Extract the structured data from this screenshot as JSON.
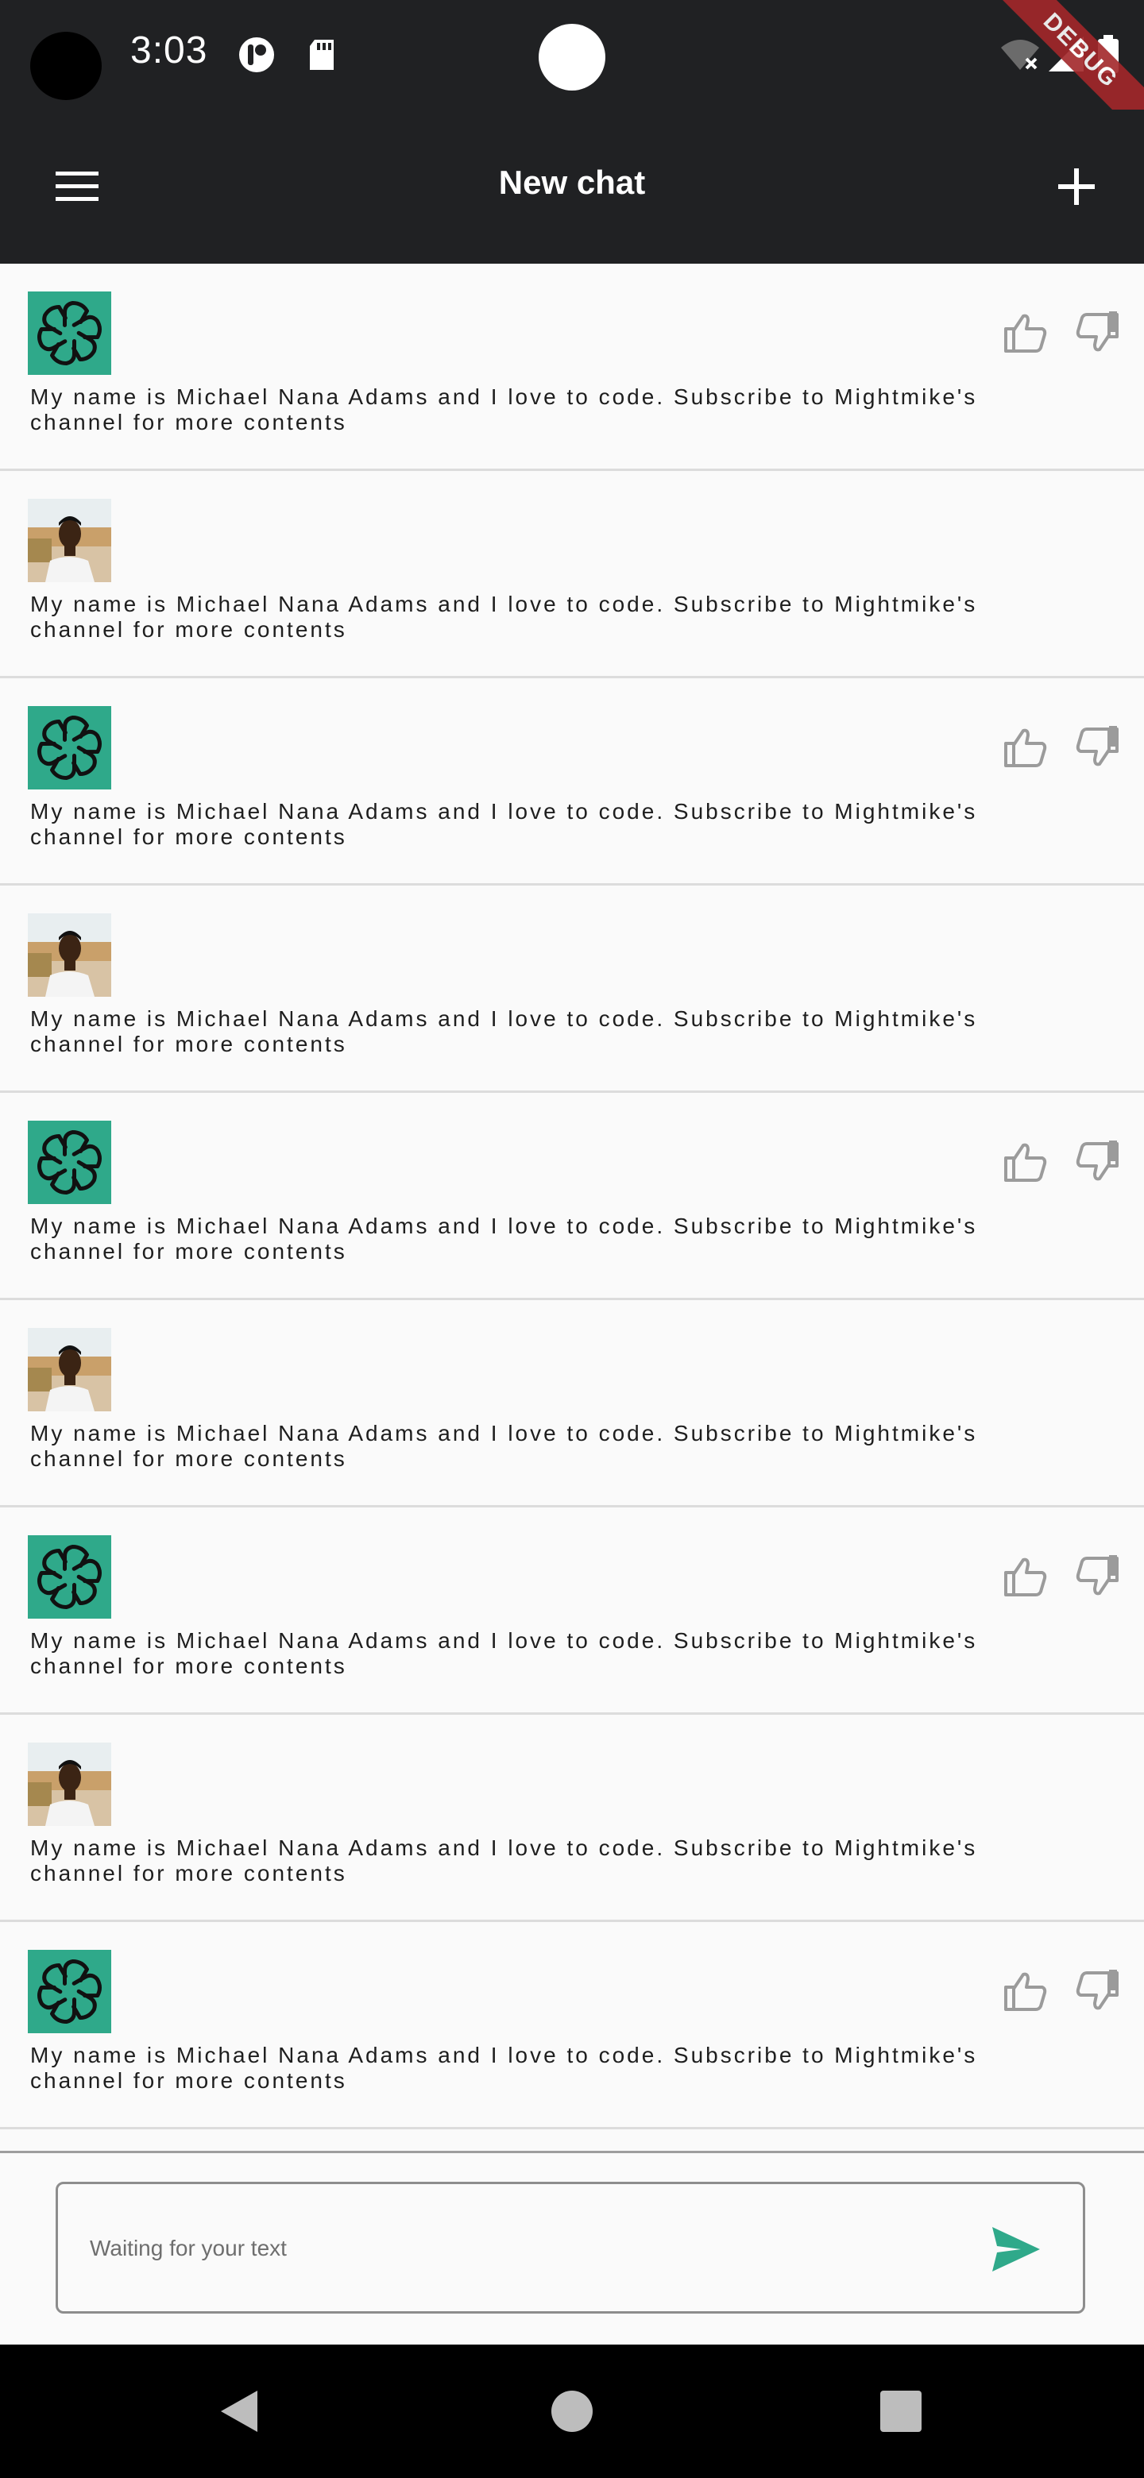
{
  "status_bar": {
    "time": "3:03",
    "icons": [
      "camera-hole",
      "app-notification-icon",
      "sd-card-icon",
      "wifi-off-icon",
      "signal-icon",
      "battery-icon"
    ],
    "debug_banner": "DEBUG"
  },
  "app_bar": {
    "title": "New chat",
    "menu_icon": "hamburger-menu-icon",
    "action_icon": "plus-icon"
  },
  "colors": {
    "app_bar": "#202123",
    "bot_avatar": "#2fa98a",
    "accent": "#10a37f",
    "background": "#fafafa"
  },
  "messages": [
    {
      "role": "bot",
      "text": "My name is Michael Nana Adams and I love to code. Subscribe to Mightmike's channel for more contents"
    },
    {
      "role": "user",
      "text": "My name is Michael Nana Adams and I love to code. Subscribe to Mightmike's channel for more contents"
    },
    {
      "role": "bot",
      "text": "My name is Michael Nana Adams and I love to code. Subscribe to Mightmike's channel for more contents"
    },
    {
      "role": "user",
      "text": "My name is Michael Nana Adams and I love to code. Subscribe to Mightmike's channel for more contents"
    },
    {
      "role": "bot",
      "text": "My name is Michael Nana Adams and I love to code. Subscribe to Mightmike's channel for more contents"
    },
    {
      "role": "user",
      "text": "My name is Michael Nana Adams and I love to code. Subscribe to Mightmike's channel for more contents"
    },
    {
      "role": "bot",
      "text": "My name is Michael Nana Adams and I love to code. Subscribe to Mightmike's channel for more contents"
    },
    {
      "role": "user",
      "text": "My name is Michael Nana Adams and I love to code. Subscribe to Mightmike's channel for more contents"
    },
    {
      "role": "bot",
      "text": "My name is Michael Nana Adams and I love to code. Subscribe to Mightmike's channel for more contents"
    },
    {
      "role": "user",
      "text": ""
    }
  ],
  "input": {
    "value": "",
    "placeholder": "Waiting for your text",
    "send_icon": "send-icon"
  },
  "nav_bar": {
    "icons": [
      "back-icon",
      "home-icon",
      "recents-icon"
    ]
  }
}
